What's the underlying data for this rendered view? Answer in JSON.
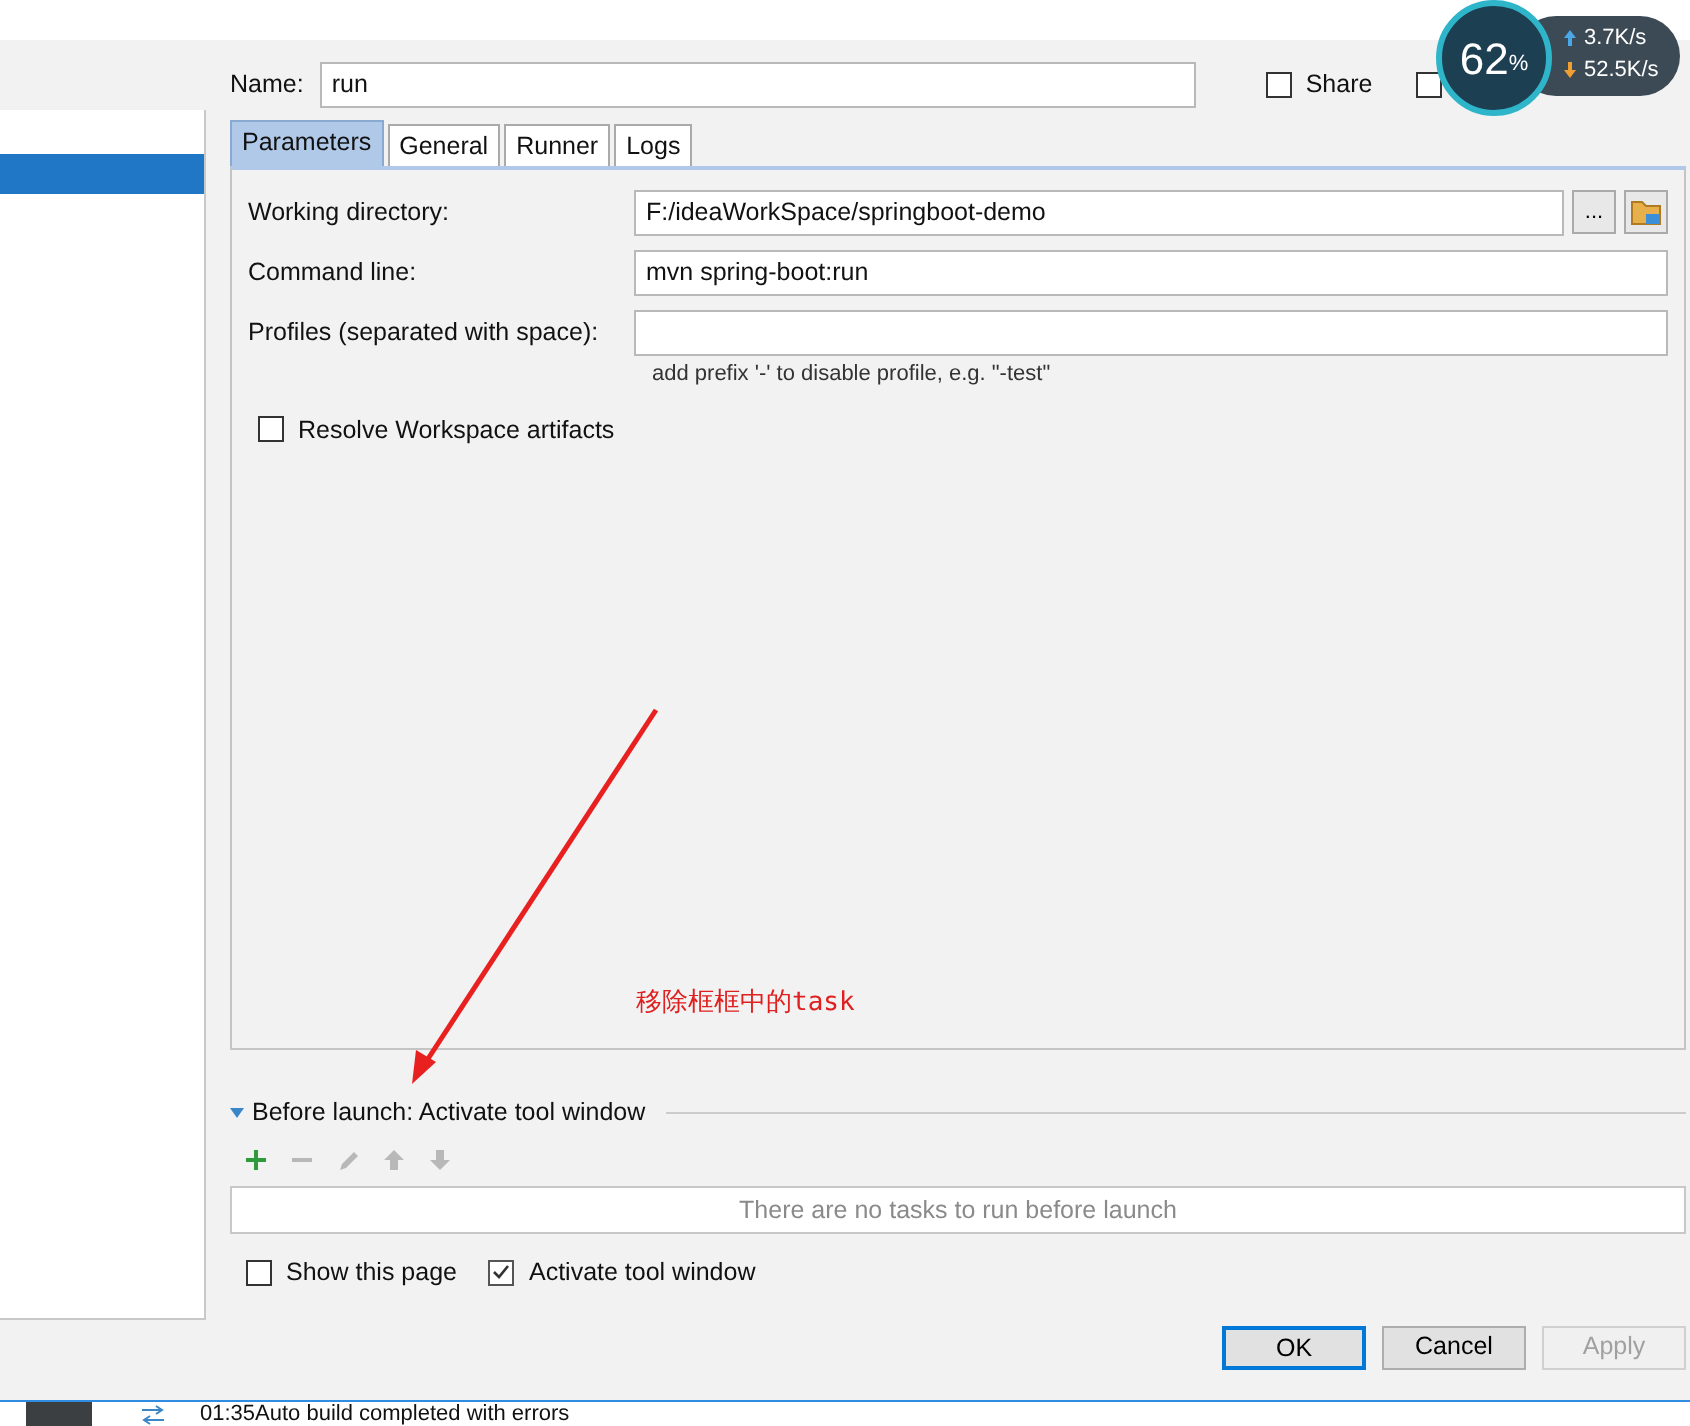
{
  "sidebar": {
    "rows": [
      {
        "selected": true
      }
    ]
  },
  "name": {
    "label": "Name:",
    "value": "run"
  },
  "options": [
    {
      "label": "Share",
      "checked": false
    },
    {
      "checked": false
    }
  ],
  "tabs": [
    {
      "label": "Parameters",
      "selected": true
    },
    {
      "label": "General",
      "selected": false
    },
    {
      "label": "Runner",
      "selected": false
    },
    {
      "label": "Logs",
      "selected": false
    }
  ],
  "fields": [
    {
      "label": "Working directory:",
      "value": "F:/ideaWorkSpace/springboot-demo",
      "browse_button": "..."
    },
    {
      "label": "Command line:",
      "value": "mvn spring-boot:run"
    },
    {
      "label": "Profiles (separated with space):",
      "hint": "add prefix '-' to disable profile, e.g. \"-test\""
    }
  ],
  "resolve_workspace": {
    "label": "Resolve Workspace artifacts",
    "checked": false
  },
  "annotation": {
    "text": "移除框框中的task"
  },
  "before_launch": {
    "title": "Before launch: Activate tool window",
    "expanded": true,
    "tools": [
      {
        "kind": "add",
        "disabled": false
      },
      {
        "kind": "remove",
        "disabled": true
      },
      {
        "kind": "edit",
        "disabled": true
      },
      {
        "kind": "up",
        "disabled": true
      },
      {
        "kind": "down",
        "disabled": true
      }
    ],
    "empty_text": "There are no tasks to run before launch"
  },
  "launch_options": [
    {
      "label": "Show this page",
      "checked": false
    },
    {
      "label": "Activate tool window",
      "checked": true
    }
  ],
  "buttons": [
    {
      "label": "OK",
      "default": true,
      "disabled": false
    },
    {
      "label": "Cancel",
      "default": false,
      "disabled": false
    },
    {
      "label": "Apply",
      "default": false,
      "disabled": true
    }
  ],
  "status_bar": {
    "text": "01:35Auto build completed with errors"
  },
  "net_monitor": {
    "percent": "62",
    "percent_unit": "%",
    "upload": "3.7K/s",
    "download": "52.5K/s"
  }
}
